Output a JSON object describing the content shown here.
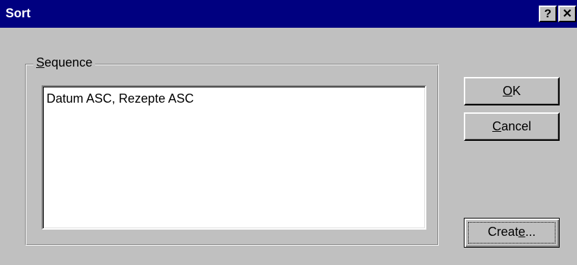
{
  "window": {
    "title": "Sort",
    "help_glyph": "?",
    "close_glyph": "✕"
  },
  "group": {
    "label_underlined": "S",
    "label_rest": "equence"
  },
  "sequence_list": {
    "items": [
      "Datum ASC, Rezepte ASC"
    ]
  },
  "buttons": {
    "ok": {
      "underlined": "O",
      "rest": "K"
    },
    "cancel": {
      "underlined": "C",
      "rest": "ancel"
    },
    "create": {
      "before": "Creat",
      "underlined": "e",
      "after": "..."
    }
  }
}
